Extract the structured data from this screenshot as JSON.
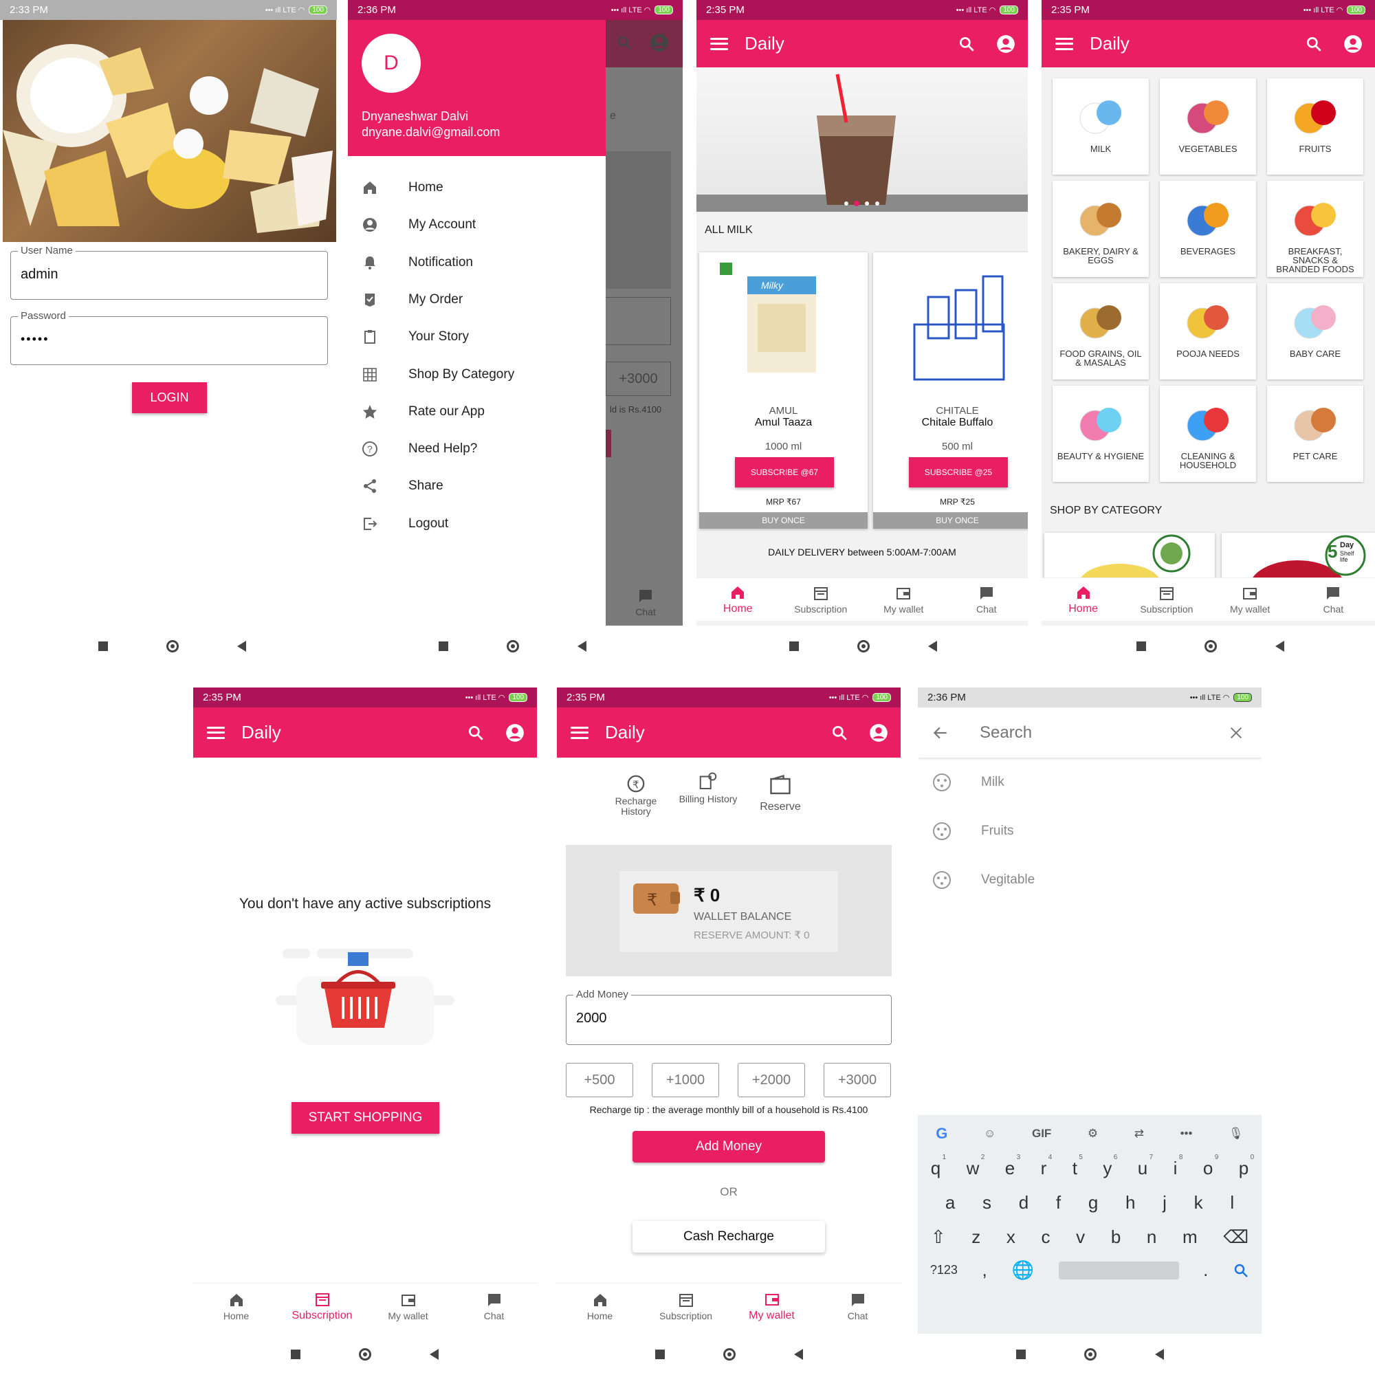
{
  "colors": {
    "accent": "#e91e63",
    "status_dark": "#ad1457"
  },
  "login": {
    "time": "2:33 PM",
    "battery": "100",
    "username_label": "User Name",
    "username_value": "admin",
    "password_label": "Password",
    "password_value": "•••••",
    "login_button": "LOGIN"
  },
  "drawer": {
    "time": "2:36 PM",
    "battery": "100",
    "avatar_letter": "D",
    "user_name": "Dnyaneshwar Dalvi",
    "user_email": "dnyane.dalvi@gmail.com",
    "items": [
      {
        "label": "Home",
        "icon": "home-icon"
      },
      {
        "label": "My Account",
        "icon": "account-icon"
      },
      {
        "label": "Notification",
        "icon": "bell-icon"
      },
      {
        "label": "My Order",
        "icon": "order-icon"
      },
      {
        "label": "Your Story",
        "icon": "clipboard-icon"
      },
      {
        "label": "Shop By Category",
        "icon": "grid-icon"
      },
      {
        "label": "Rate our App",
        "icon": "star-icon"
      },
      {
        "label": "Need Help?",
        "icon": "help-icon"
      },
      {
        "label": "Share",
        "icon": "share-icon"
      },
      {
        "label": "Logout",
        "icon": "logout-icon"
      }
    ],
    "behind_plus3000": "+3000",
    "behind_tip": "ld is Rs.4100",
    "behind_e": "e",
    "behind_chat": "Chat"
  },
  "home": {
    "time": "2:35 PM",
    "battery": "100",
    "title": "Daily",
    "section_title": "ALL MILK",
    "products": [
      {
        "brand": "AMUL",
        "name": "Amul Taaza",
        "qty": "1000 ml",
        "subscribe": "SUBSCRIBE @67",
        "mrp": "MRP ₹67",
        "buy": "BUY ONCE"
      },
      {
        "brand": "CHITALE",
        "name": "Chitale Buffalo",
        "qty": "500 ml",
        "subscribe": "SUBSCRIBE @25",
        "mrp": "MRP ₹25",
        "buy": "BUY ONCE"
      }
    ],
    "delivery": "DAILY DELIVERY between 5:00AM-7:00AM"
  },
  "category": {
    "time": "2:35 PM",
    "battery": "100",
    "title": "Daily",
    "items": [
      "MILK",
      "VEGETABLES",
      "FRUITS",
      "BAKERY, DAIRY & EGGS",
      "BEVERAGES",
      "BREAKFAST, SNACKS & BRANDED FOODS",
      "FOOD GRAINS, OIL & MASALAS",
      "POOJA NEEDS",
      "BABY CARE",
      "BEAUTY & HYGIENE",
      "CLEANING & HOUSEHOLD",
      "PET CARE"
    ],
    "shop_by_category": "SHOP BY CATEGORY",
    "badge_5": "5",
    "badge_day": "Day",
    "badge_shelf": "Shelf life"
  },
  "nav": {
    "home": "Home",
    "subscription": "Subscription",
    "wallet": "My wallet",
    "chat": "Chat"
  },
  "subscription": {
    "time": "2:35 PM",
    "battery": "100",
    "title": "Daily",
    "message": "You don't have any active subscriptions",
    "button": "START SHOPPING"
  },
  "wallet": {
    "time": "2:35 PM",
    "battery": "100",
    "title": "Daily",
    "tab_recharge": "Recharge History",
    "tab_billing": "Billing History",
    "tab_reserve": "Reserve",
    "balance": "₹ 0",
    "balance_label": "WALLET BALANCE",
    "reserve_label": "RESERVE AMOUNT: ₹ 0",
    "add_money_label": "Add Money",
    "add_money_value": "2000",
    "quick": [
      "+500",
      "+1000",
      "+2000",
      "+3000"
    ],
    "tip": "Recharge tip : the average monthly bill of a household is Rs.4100",
    "add_button": "Add Money",
    "or": "OR",
    "cash_button": "Cash Recharge"
  },
  "search": {
    "time": "2:36 PM",
    "battery": "100",
    "placeholder": "Search",
    "results": [
      "Milk",
      "Fruits",
      "Vegitable"
    ],
    "kb_toolbar": [
      "G",
      "GIF"
    ],
    "row1": [
      "q",
      "w",
      "e",
      "r",
      "t",
      "y",
      "u",
      "i",
      "o",
      "p"
    ],
    "row1_nums": [
      "1",
      "2",
      "3",
      "4",
      "5",
      "6",
      "7",
      "8",
      "9",
      "0"
    ],
    "row2": [
      "a",
      "s",
      "d",
      "f",
      "g",
      "h",
      "j",
      "k",
      "l"
    ],
    "row3": [
      "z",
      "x",
      "c",
      "v",
      "b",
      "n",
      "m"
    ],
    "sym": "?123",
    "comma": ",",
    "period": "."
  }
}
